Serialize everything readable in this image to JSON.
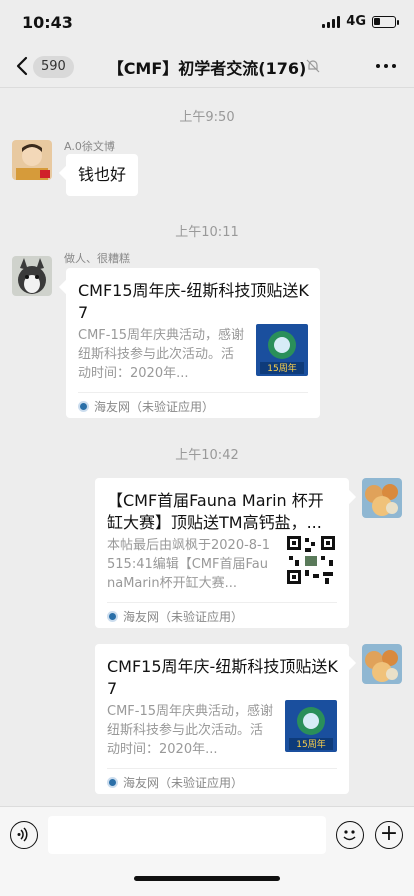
{
  "status_bar": {
    "time": "10:43",
    "network": "4G"
  },
  "nav": {
    "back_count": "590",
    "title": "【CMF】初学者交流(176)"
  },
  "messages": {
    "t1": "上午9:50",
    "m1": {
      "sender": "A.0徐文博",
      "text": "钱也好"
    },
    "t2": "上午10:11",
    "m2": {
      "sender": "做人、很糟糕",
      "card": {
        "title": "CMF15周年庆-纽斯科技顶贴送K7",
        "desc": "CMF-15周年庆典活动，感谢纽斯科技参与此次活动。活动时间：2020年...",
        "thumb_text": "15周年",
        "source": "海友网（未验证应用）"
      }
    },
    "t3": "上午10:42",
    "m3": {
      "card": {
        "title": "【CMF首届Fauna Marin 杯开缸大赛】顶贴送TM高钙盐，...",
        "desc": "本帖最后由飒枫于2020-8-1515:41编辑【CMF首届FaunaMarin杯开缸大赛...",
        "source": "海友网（未验证应用）"
      }
    },
    "m4": {
      "card": {
        "title": "CMF15周年庆-纽斯科技顶贴送K7",
        "desc": "CMF-15周年庆典活动，感谢纽斯科技参与此次活动。活动时间：2020年...",
        "thumb_text": "15周年",
        "source": "海友网（未验证应用）"
      }
    }
  },
  "colors": {
    "background": "#ededed",
    "bubble": "#ffffff",
    "meta_text": "#999999"
  }
}
